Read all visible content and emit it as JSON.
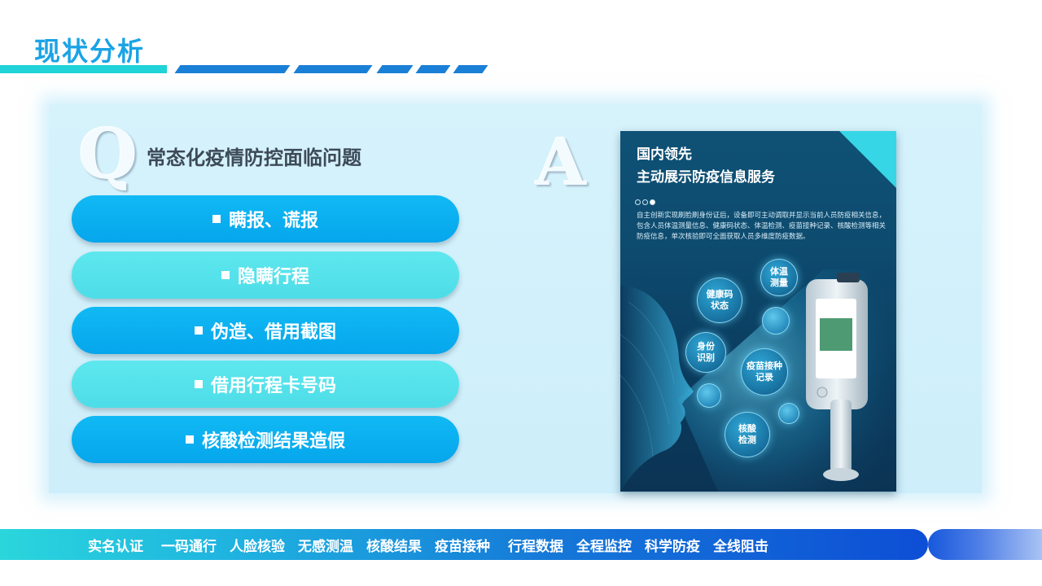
{
  "page": {
    "title": "现状分析"
  },
  "question": {
    "letter": "Q",
    "heading": "常态化疫情防控面临问题"
  },
  "answer": {
    "letter": "A"
  },
  "problems": [
    "瞒报、谎报",
    "隐瞒行程",
    "伪造、借用截图",
    "借用行程卡号码",
    "核酸检测结果造假"
  ],
  "poster": {
    "line1": "国内领先",
    "line2": "主动展示防疫信息服务",
    "description": "自主创新实现刷脸刷身份证后，设备即可主动调取并显示当前人员防疫相关信息，包含人员体温测量信息、健康码状态、体温检测、疫苗接种记录、核酸检测等相关防疫信息，单次核验即可全面获取人员多维度防疫数据。",
    "bubbles": {
      "temp": "体温\n测量",
      "health": "健康码\n状态",
      "id": "身份\n识别",
      "vaccine": "疫苗接种\n记录",
      "nucleic": "核酸\n检测"
    }
  },
  "bottom_items": [
    "实名认证",
    "一码通行",
    "人脸核验",
    "无感测温",
    "核酸结果",
    "疫苗接种",
    "行程数据",
    "全程监控",
    "科学防疫",
    "全线阻击"
  ],
  "colors": {
    "title": "#1aa3e6",
    "pill_blue": "#06a6ec",
    "pill_cyan": "#4ddde8",
    "panel": "#d6f3fc",
    "poster_bg": "#0d4a6e",
    "poster_corner": "#37d6e6"
  }
}
